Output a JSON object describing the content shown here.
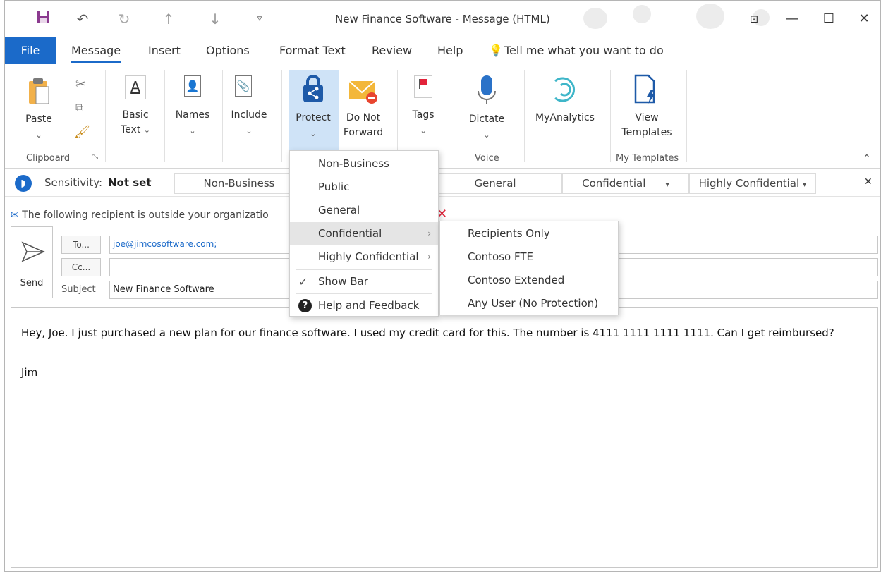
{
  "window": {
    "title": "New Finance Software  -  Message (HTML)"
  },
  "tabs": {
    "file": "File",
    "items": [
      "Message",
      "Insert",
      "Options",
      "Format Text",
      "Review",
      "Help"
    ],
    "tell_me": "Tell me what you want to do"
  },
  "ribbon": {
    "paste": "Paste",
    "basic_text_1": "Basic",
    "basic_text_2": "Text",
    "names": "Names",
    "include": "Include",
    "protect": "Protect",
    "do_not_1": "Do Not",
    "do_not_2": "Forward",
    "tags": "Tags",
    "dictate": "Dictate",
    "myanalytics": "MyAnalytics",
    "view_1": "View",
    "view_2": "Templates",
    "group_clipboard": "Clipboard",
    "group_voice": "Voice",
    "group_templates": "My Templates"
  },
  "sensitivity_bar": {
    "label": "Sensitivity:",
    "value": "Not set",
    "non_business": "Non-Business",
    "general": "General",
    "confidential": "Confidential",
    "highly_confidential": "Highly Confidential"
  },
  "compose": {
    "info": "The following recipient is outside your organizatio",
    "to_btn": "To...",
    "cc_btn": "Cc...",
    "send": "Send",
    "subject_label": "Subject",
    "to_value": "joe@jimcosoftware.com;",
    "subject_value": "New Finance Software",
    "body_line1": "Hey, Joe. I just purchased a new plan for our finance software. I used my credit card for this. The number is 4111 1111 1111 1111. Can I get reimbursed?",
    "body_sign": "Jim"
  },
  "protect_menu": {
    "items": [
      "Non-Business",
      "Public",
      "General",
      "Confidential",
      "Highly Confidential"
    ],
    "show_bar": "Show Bar",
    "help": "Help and Feedback"
  },
  "sub_menu": {
    "items": [
      "Recipients Only",
      "Contoso FTE",
      "Contoso Extended",
      "Any User (No Protection)"
    ]
  },
  "colors": {
    "accent": "#1b6ac9",
    "protect_icon": "#1e5aa8",
    "envelope": "#f3b73a",
    "block": "#e8452f",
    "flag": "#e2233a"
  }
}
